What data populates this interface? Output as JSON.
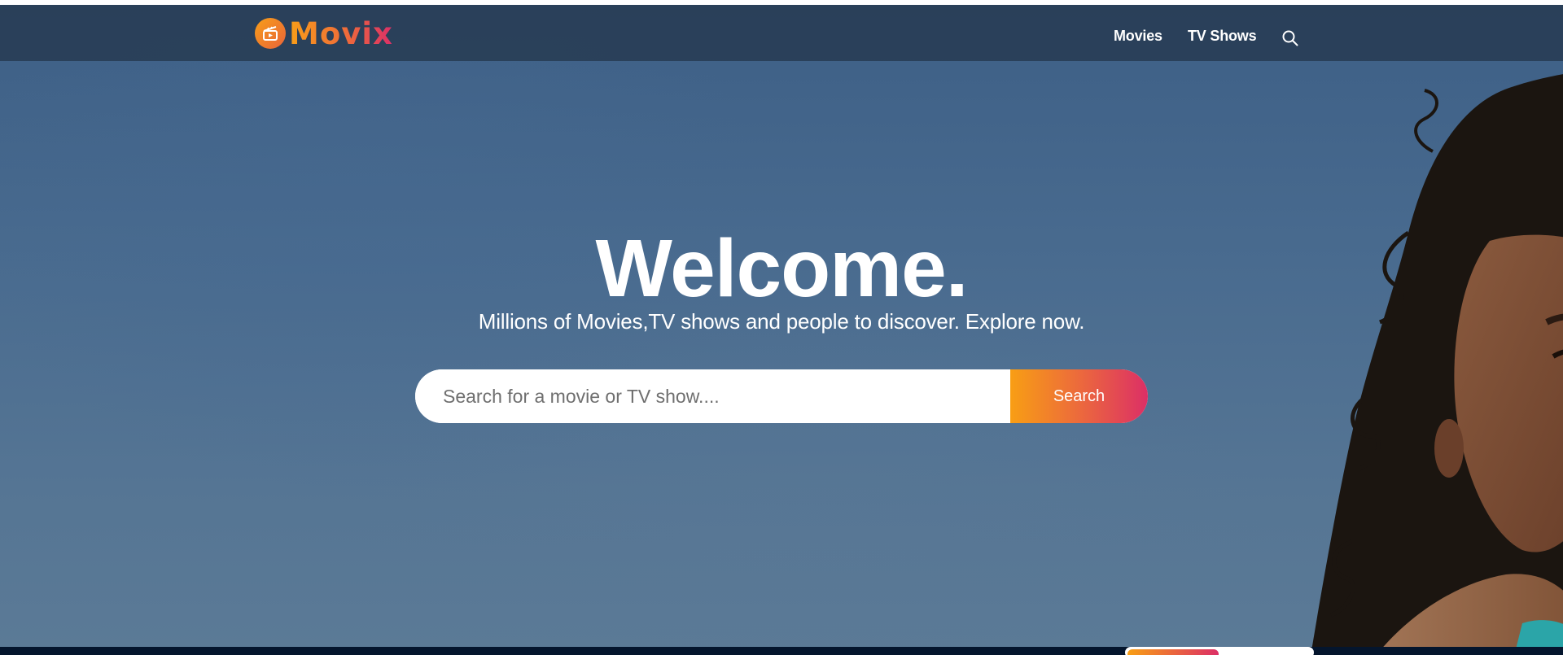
{
  "app": {
    "brand": "Movix",
    "colors": {
      "accent_start": "#f89e14",
      "accent_end": "#dc2f66",
      "header_bg": "#2c4660",
      "dark_bg": "#04152d"
    }
  },
  "header": {
    "logo_icon": "clapperboard-icon",
    "nav": [
      {
        "label": "Movies"
      },
      {
        "label": "TV Shows"
      }
    ],
    "search_icon": "search-icon"
  },
  "hero": {
    "title": "Welcome.",
    "subtitle": "Millions of Movies,TV shows and people to discover. Explore now.",
    "search": {
      "placeholder": "Search for a movie or TV show....",
      "value": "",
      "button_label": "Search"
    }
  }
}
